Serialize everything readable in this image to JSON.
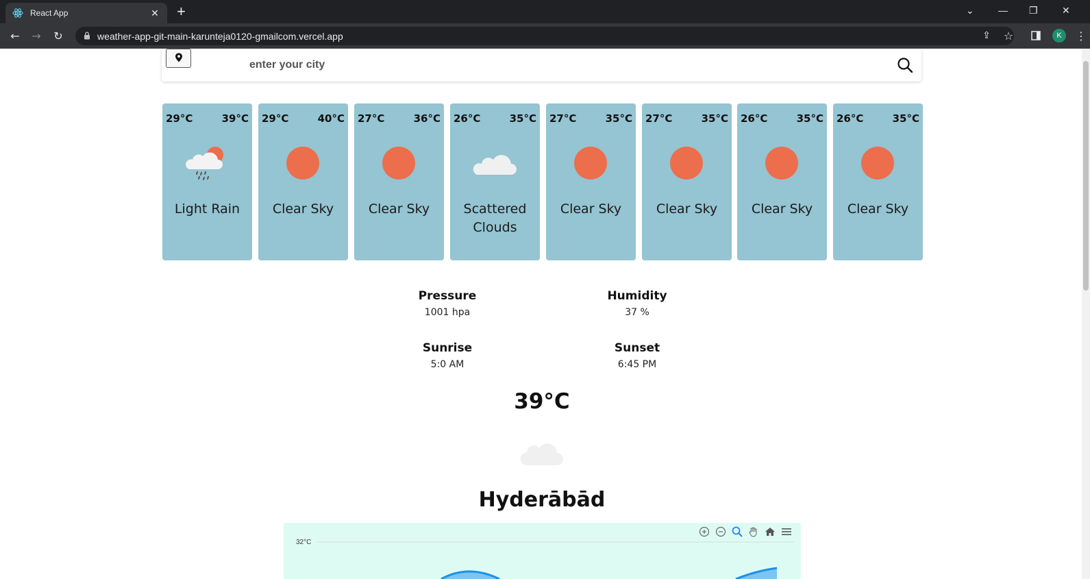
{
  "browser": {
    "tab_title": "React App",
    "url": "weather-app-git-main-karunteja0120-gmailcom.vercel.app",
    "profile_initial": "K"
  },
  "search": {
    "placeholder": "enter your city",
    "value": ""
  },
  "forecast": [
    {
      "min": "29°C",
      "max": "39°C",
      "desc": "Light Rain",
      "icon": "rain-cloud-sun-icon"
    },
    {
      "min": "29°C",
      "max": "40°C",
      "desc": "Clear Sky",
      "icon": "sun-icon"
    },
    {
      "min": "27°C",
      "max": "36°C",
      "desc": "Clear Sky",
      "icon": "sun-icon"
    },
    {
      "min": "26°C",
      "max": "35°C",
      "desc": "Scattered Clouds",
      "icon": "cloud-icon"
    },
    {
      "min": "27°C",
      "max": "35°C",
      "desc": "Clear Sky",
      "icon": "sun-icon"
    },
    {
      "min": "27°C",
      "max": "35°C",
      "desc": "Clear Sky",
      "icon": "sun-icon"
    },
    {
      "min": "26°C",
      "max": "35°C",
      "desc": "Clear Sky",
      "icon": "sun-icon"
    },
    {
      "min": "26°C",
      "max": "35°C",
      "desc": "Clear Sky",
      "icon": "sun-icon"
    }
  ],
  "stats": {
    "pressure": {
      "label": "Pressure",
      "value": "1001 hpa"
    },
    "humidity": {
      "label": "Humidity",
      "value": "37 %"
    },
    "sunrise": {
      "label": "Sunrise",
      "value": "5:0 AM"
    },
    "sunset": {
      "label": "Sunset",
      "value": "6:45 PM"
    }
  },
  "current": {
    "temp": "39°C",
    "icon": "cloud-icon",
    "city": "Hyderābād"
  },
  "chart_data": {
    "type": "area",
    "title": "",
    "xlabel": "",
    "ylabel": "",
    "ytick_labels": [
      "32°C"
    ],
    "colors": {
      "background": "#defbf3",
      "series": "#1e90e6",
      "fill": "#7cc4f2"
    }
  },
  "colors": {
    "card_bg": "#95c4d2",
    "sun": "#ec6e4c",
    "cloud": "#f0f0f0"
  }
}
